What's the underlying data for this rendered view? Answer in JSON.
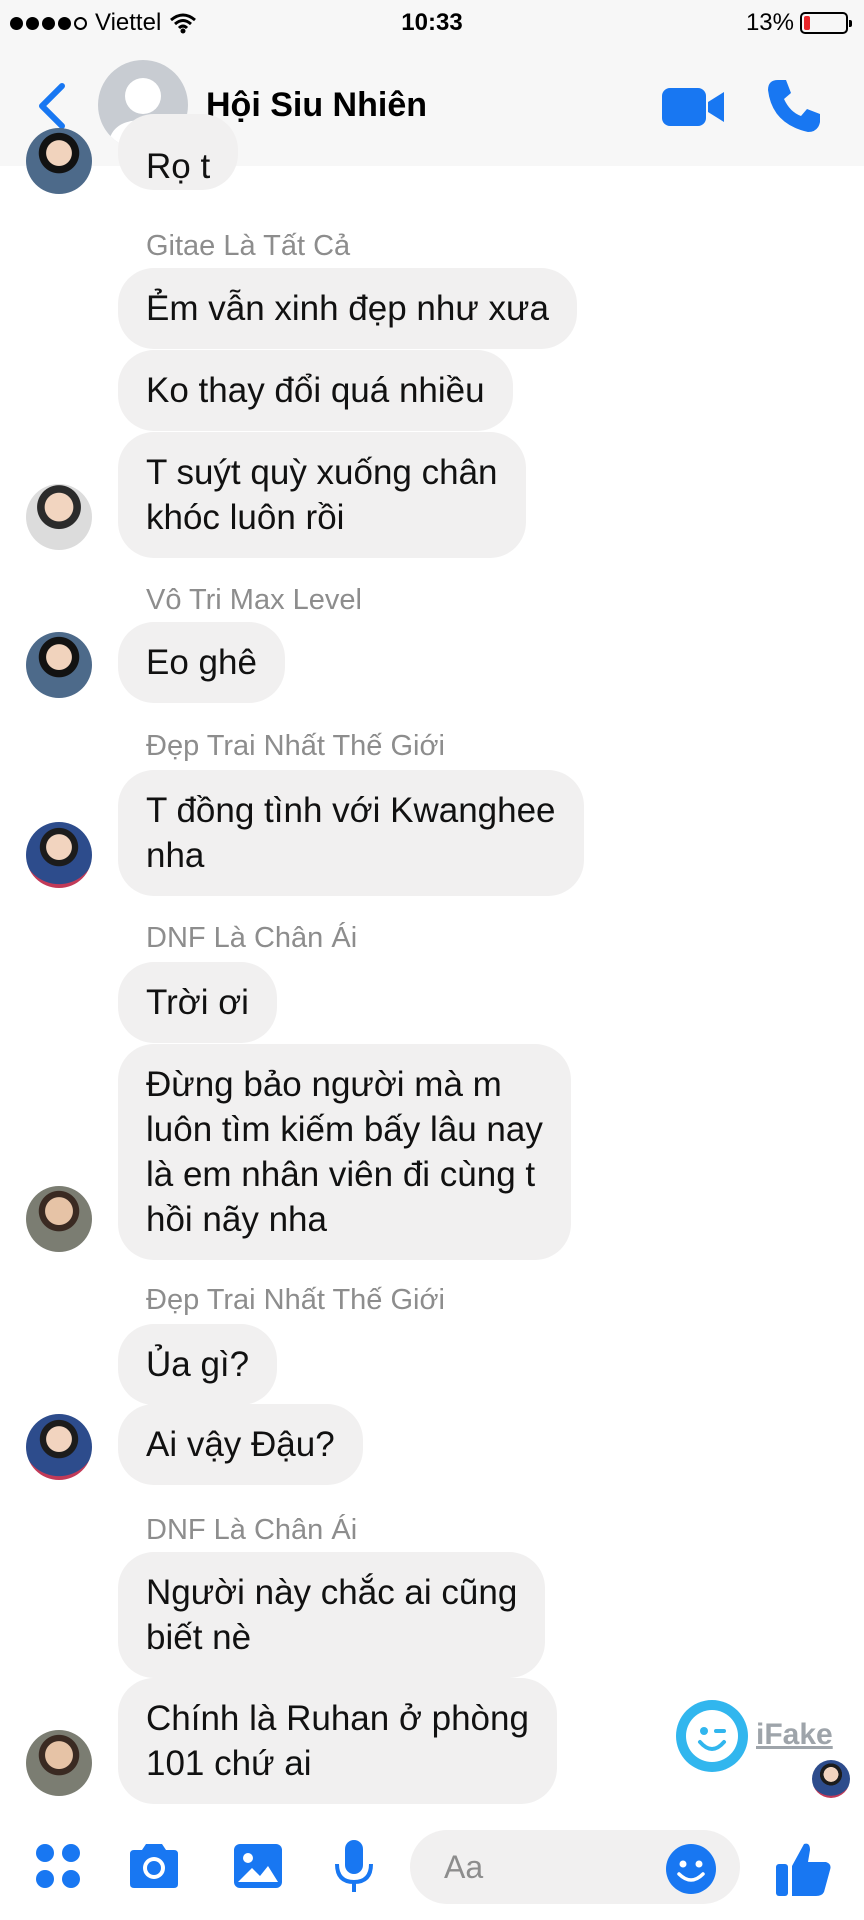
{
  "status_bar": {
    "carrier": "Viettel",
    "time": "10:33",
    "battery": "13%",
    "battery_level": 0.13
  },
  "header": {
    "title": "Hội Siu Nhiên",
    "icons": [
      "back-chevron-icon",
      "video-call-icon",
      "phone-call-icon"
    ]
  },
  "messages": {
    "partial": "Rọ t",
    "group1": {
      "sender": "Gitae Là Tất Cả",
      "m1": "Ẻm vẫn xinh đẹp như xưa",
      "m2": "Ko thay đổi quá nhiều",
      "m3_l1": "T suýt quỳ xuống chân",
      "m3_l2": "khóc luôn rồi"
    },
    "group2": {
      "sender": "Vô Tri Max Level",
      "m1": "Eo ghê"
    },
    "group3": {
      "sender": "Đẹp Trai Nhất Thế Giới",
      "m1_l1": "T đồng tình với Kwanghee",
      "m1_l2": "nha"
    },
    "group4": {
      "sender": "DNF Là Chân Ái",
      "m1": "Trời ơi",
      "m2_l1": "Đừng bảo người mà m",
      "m2_l2": "luôn tìm kiếm bấy lâu nay",
      "m2_l3": "là em nhân viên đi cùng t",
      "m2_l4": "hồi nãy nha"
    },
    "group5": {
      "sender": "Đẹp Trai Nhất Thế Giới",
      "m1": "Ủa gì?",
      "m2": "Ai vậy Đậu?"
    },
    "group6": {
      "sender": "DNF Là Chân Ái",
      "m1_l1": "Người này chắc ai cũng",
      "m1_l2": "biết nè",
      "m2_l1": "Chính là Ruhan ở phòng",
      "m2_l2": "101 chứ ai"
    }
  },
  "watermark": {
    "text": "iFake"
  },
  "composer": {
    "placeholder": "Aa"
  },
  "colors": {
    "accent": "#1877f2",
    "bubble": "#f1f0f0",
    "sender": "#8d8d8d",
    "ifake": "#31b6ee"
  }
}
